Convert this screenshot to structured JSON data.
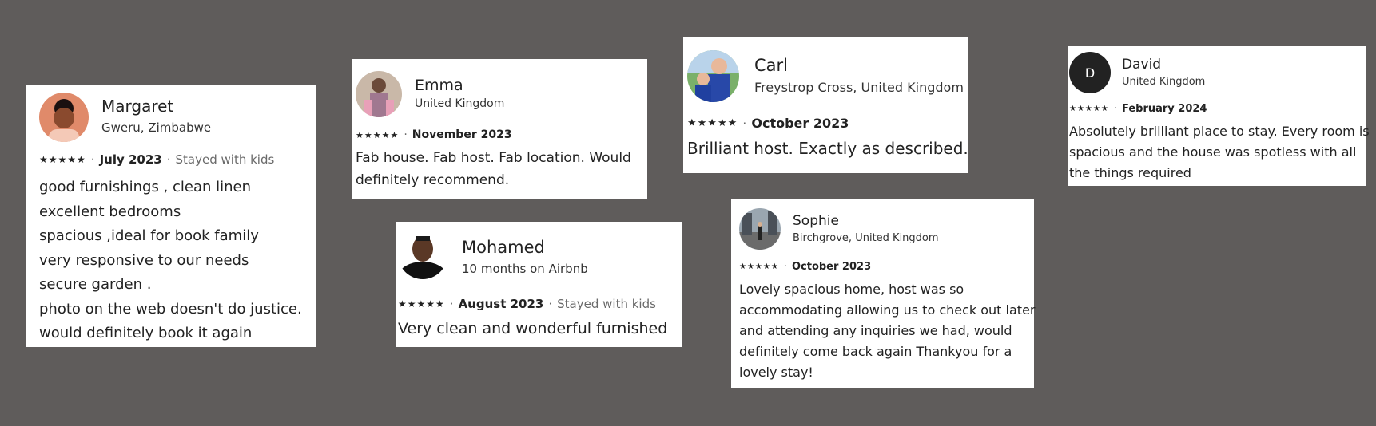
{
  "reviews": [
    {
      "name": "Margaret",
      "location": "Gweru, Zimbabwe",
      "stars": "★★★★★",
      "date": "July 2023",
      "extra": "Stayed with kids",
      "lines": [
        "good furnishings , clean linen",
        "excellent bedrooms",
        "spacious ,ideal for book family",
        "very responsive to our needs",
        "secure garden .",
        "photo on the web doesn't do justice.",
        "would definitely book it again"
      ]
    },
    {
      "name": "Emma",
      "location": "United Kingdom",
      "stars": "★★★★★",
      "date": "November 2023",
      "lines": [
        "Fab house. Fab host. Fab location. Would",
        "definitely recommend."
      ]
    },
    {
      "name": "Mohamed",
      "location": "10 months on Airbnb",
      "stars": "★★★★★",
      "date": "August 2023",
      "extra": "Stayed with kids",
      "lines": [
        "Very clean and wonderful furnished"
      ]
    },
    {
      "name": "Carl",
      "location": "Freystrop Cross, United Kingdom",
      "stars": "★★★★★",
      "date": "October 2023",
      "lines": [
        "Brilliant host. Exactly as described."
      ]
    },
    {
      "name": "Sophie",
      "location": "Birchgrove, United Kingdom",
      "stars": "★★★★★",
      "date": "October 2023",
      "lines": [
        "Lovely spacious home, host was so",
        "accommodating allowing us to check out later",
        "and attending any inquiries we had, would",
        "definitely come back again Thankyou for a",
        "lovely stay!"
      ]
    },
    {
      "name": "David",
      "avatar_initial": "D",
      "location": "United Kingdom",
      "stars": "★★★★★",
      "date": "February 2024",
      "lines": [
        "Absolutely brilliant place to stay. Every room is",
        "spacious and the house was spotless with all",
        "the things required"
      ]
    }
  ],
  "colors": {
    "background": "#5f5c5b",
    "card": "#ffffff",
    "text": "#222222",
    "muted": "#6a6a6a"
  }
}
